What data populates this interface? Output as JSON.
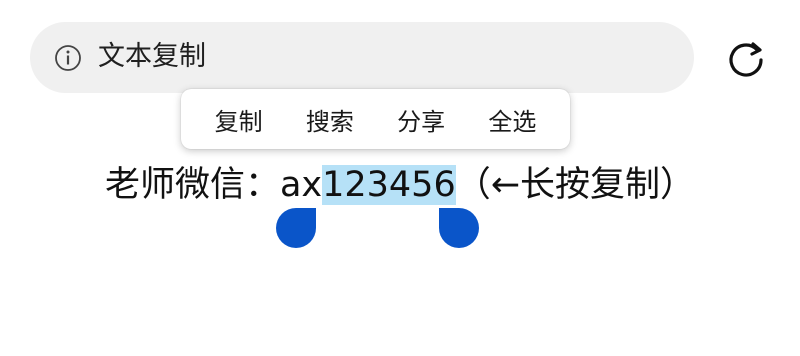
{
  "address_bar": {
    "text": "文本复制",
    "info_icon": "info-circle-icon",
    "refresh_icon": "refresh-icon"
  },
  "context_menu": {
    "items": [
      {
        "label": "复制"
      },
      {
        "label": "搜索"
      },
      {
        "label": "分享"
      },
      {
        "label": "全选"
      }
    ]
  },
  "content": {
    "prefix": "老师微信：ax",
    "selected": "123456",
    "suffix": "（←长按复制）"
  },
  "colors": {
    "selection_highlight": "#b6e1f7",
    "selection_handle": "#0a55c9",
    "address_bar_bg": "#f0f0f0"
  }
}
